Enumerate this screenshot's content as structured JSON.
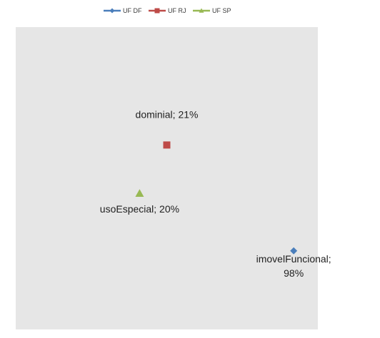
{
  "chart_data": {
    "type": "scatter",
    "title": "",
    "xlabel": "",
    "ylabel": "",
    "grid": false,
    "legend_position": "top",
    "plot_background": "#e6e6e6",
    "series": [
      {
        "name": "UF DF",
        "marker": "diamond",
        "color": "#4a7ebb",
        "points": [
          {
            "x": 0.92,
            "y": 0.26,
            "label": [
              "imovelFuncional;",
              "98%"
            ]
          }
        ]
      },
      {
        "name": "UF RJ",
        "marker": "square",
        "color": "#be4b48",
        "points": [
          {
            "x": 0.5,
            "y": 0.61,
            "label": [
              "dominial; 21%"
            ]
          }
        ]
      },
      {
        "name": "UF SP",
        "marker": "triangle",
        "color": "#98b954",
        "points": [
          {
            "x": 0.41,
            "y": 0.45,
            "label": [
              "usoEspecial; 20%"
            ]
          }
        ]
      }
    ]
  }
}
